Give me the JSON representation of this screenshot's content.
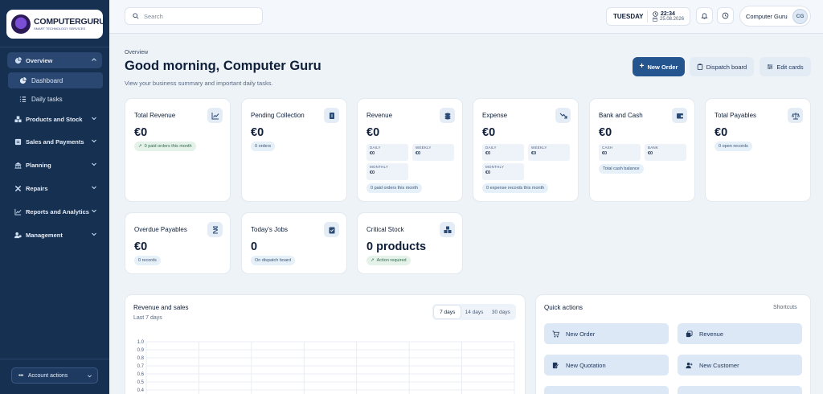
{
  "brand": {
    "name": "COMPUTERGURU",
    "tagline": "SMART TECHNOLOGY SERVICES"
  },
  "sidebar": {
    "items": [
      {
        "label": "Overview",
        "icon": "overview-icon"
      },
      {
        "label": "Dashboard",
        "icon": "dashboard-icon"
      },
      {
        "label": "Daily tasks",
        "icon": "tasks-icon"
      },
      {
        "label": "Products and Stock",
        "icon": "products-icon"
      },
      {
        "label": "Sales and Payments",
        "icon": "sales-icon"
      },
      {
        "label": "Planning",
        "icon": "planning-icon"
      },
      {
        "label": "Repairs",
        "icon": "repairs-icon"
      },
      {
        "label": "Reports and Analytics",
        "icon": "reports-icon"
      },
      {
        "label": "Management",
        "icon": "management-icon"
      }
    ],
    "account_label": "Account actions"
  },
  "topbar": {
    "search_placeholder": "Search",
    "day": "TUESDAY",
    "time": "22:34",
    "date": "25.08.2026",
    "user_name": "Computer Guru",
    "user_initials": "CG"
  },
  "header": {
    "breadcrumb": "Overview",
    "greeting": "Good morning, Computer Guru",
    "subtitle": "View your business summary and important daily tasks.",
    "new_order": "New Order",
    "dispatch_board": "Dispatch board",
    "edit_cards": "Edit cards"
  },
  "cards": {
    "total_revenue": {
      "title": "Total Revenue",
      "value": "€0",
      "pill": "0 paid orders this month"
    },
    "pending_collection": {
      "title": "Pending Collection",
      "value": "€0",
      "pill": "0 orders"
    },
    "revenue": {
      "title": "Revenue",
      "value": "€0",
      "daily_label": "DAILY",
      "daily": "€0",
      "weekly_label": "WEEKLY",
      "weekly": "€0",
      "monthly_label": "MONTHLY",
      "monthly": "€0",
      "pill": "0 paid orders this month"
    },
    "expense": {
      "title": "Expense",
      "value": "€0",
      "daily_label": "DAILY",
      "daily": "€0",
      "weekly_label": "WEEKLY",
      "weekly": "€0",
      "monthly_label": "MONTHLY",
      "monthly": "€0",
      "pill": "0 expense records this month"
    },
    "bank_cash": {
      "title": "Bank and Cash",
      "value": "€0",
      "cash_label": "CASH",
      "cash": "€0",
      "bank_label": "BANK",
      "bank": "€0",
      "pill": "Total cash balance"
    },
    "total_payables": {
      "title": "Total Payables",
      "value": "€0",
      "pill": "0 open records"
    },
    "overdue_payables": {
      "title": "Overdue Payables",
      "value": "€0",
      "pill": "0 records"
    },
    "todays_jobs": {
      "title": "Today's Jobs",
      "value": "0",
      "pill": "On dispatch board"
    },
    "critical_stock": {
      "title": "Critical Stock",
      "value": "0 products",
      "pill": "Action required"
    }
  },
  "chart_panel": {
    "title": "Revenue and sales",
    "subtitle": "Last 7 days",
    "ranges": [
      "7 days",
      "14 days",
      "30 days"
    ],
    "selected_range": "7 days"
  },
  "chart_data": {
    "type": "line",
    "title": "",
    "xlabel": "",
    "ylabel": "",
    "y_ticks": [
      "1.0",
      "0.9",
      "0.8",
      "0.7",
      "0.6",
      "0.5",
      "0.4"
    ],
    "ylim": [
      0.4,
      1.0
    ],
    "grid": true,
    "series": []
  },
  "quick_actions": {
    "title": "Quick actions",
    "shortcuts_label": "Shortcuts",
    "items": [
      {
        "label": "New Order",
        "icon": "cart-icon"
      },
      {
        "label": "Revenue",
        "icon": "coins-icon"
      },
      {
        "label": "New Quotation",
        "icon": "quotation-icon"
      },
      {
        "label": "New Customer",
        "icon": "add-user-icon"
      }
    ]
  }
}
